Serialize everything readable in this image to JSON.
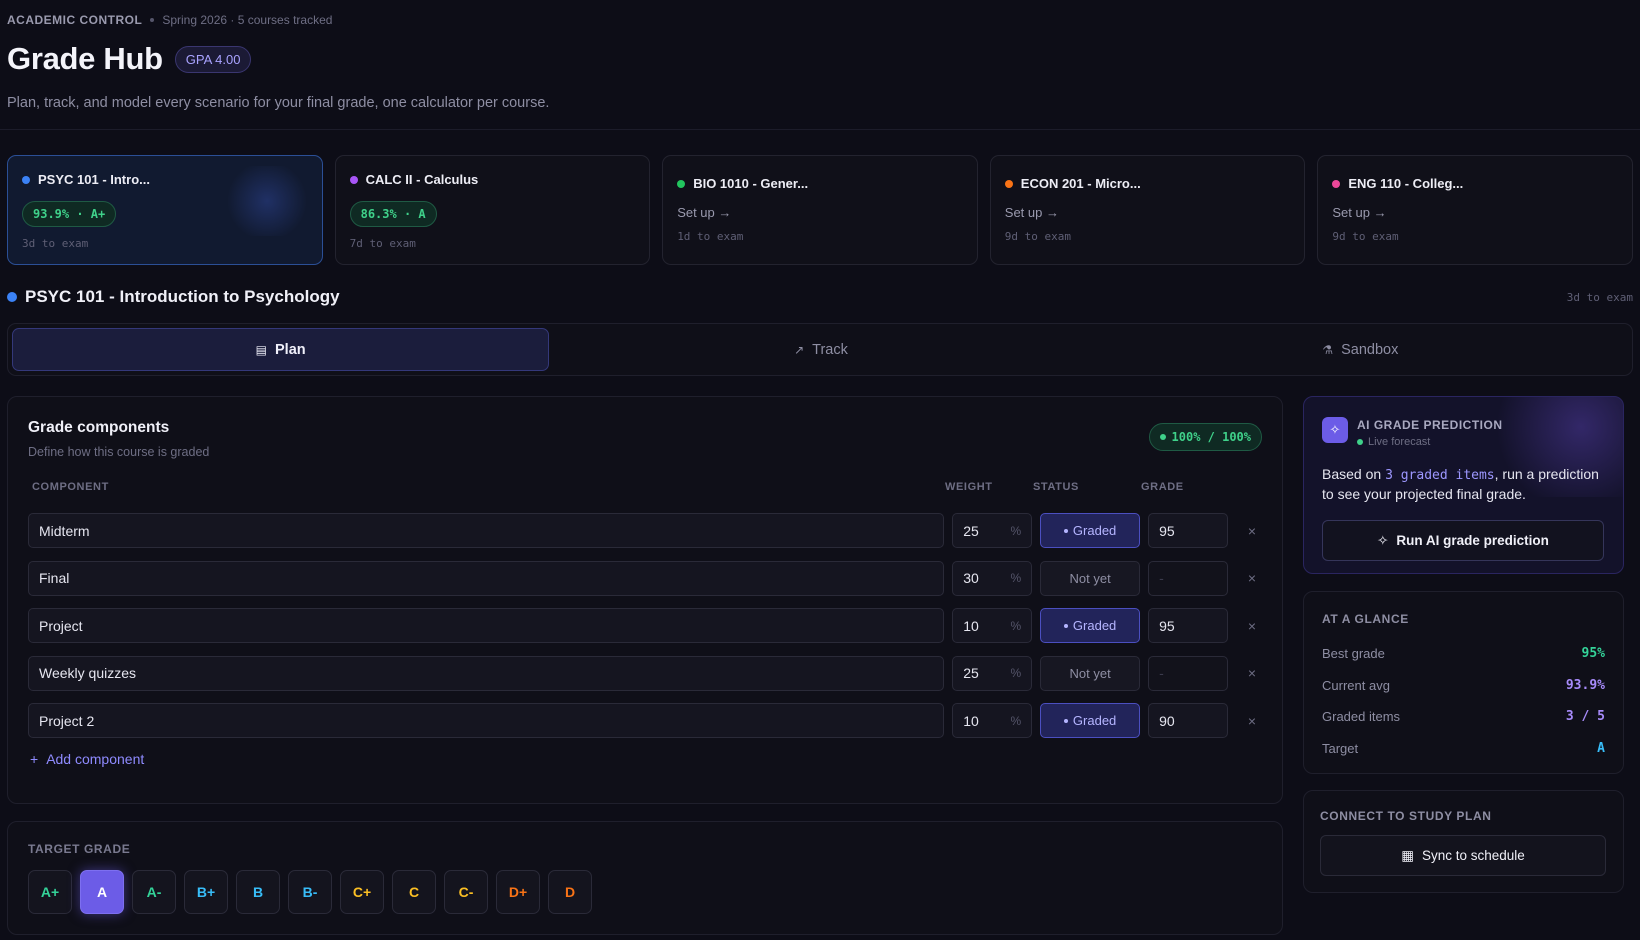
{
  "header": {
    "brand": "ACADEMIC CONTROL",
    "subtitle": "Spring 2026 · 5 courses tracked",
    "title": "Grade Hub",
    "gpa_badge": "GPA 4.00",
    "tagline": "Plan, track, and model every scenario for your final grade, one calculator per course."
  },
  "courses": [
    {
      "name": "PSYC 101 - Intro...",
      "dot_color": "#3b82f6",
      "pill": "93.9% · A+",
      "setup": "",
      "meta": "3d to exam",
      "active": true
    },
    {
      "name": "CALC II - Calculus",
      "dot_color": "#a855f7",
      "pill": "86.3% · A",
      "setup": "",
      "meta": "7d to exam",
      "active": false
    },
    {
      "name": "BIO 1010 - Gener...",
      "dot_color": "#22c55e",
      "pill": "",
      "setup": "Set up →",
      "meta": "1d to exam",
      "active": false
    },
    {
      "name": "ECON 201 - Micro...",
      "dot_color": "#f97316",
      "pill": "",
      "setup": "Set up →",
      "meta": "9d to exam",
      "active": false
    },
    {
      "name": "ENG 110 - Colleg...",
      "dot_color": "#ec4899",
      "pill": "",
      "setup": "Set up →",
      "meta": "9d to exam",
      "active": false
    }
  ],
  "course_heading": {
    "title": "PSYC 101 - Introduction to Psychology",
    "exam": "3d to exam"
  },
  "tabs": [
    {
      "label": "Plan",
      "icon": "clipboard-icon"
    },
    {
      "label": "Track",
      "icon": "trend-icon"
    },
    {
      "label": "Sandbox",
      "icon": "flask-icon"
    }
  ],
  "components": {
    "title": "Grade components",
    "desc": "Define how this course is graded",
    "total": "100% / 100%",
    "columns": [
      "COMPONENT",
      "WEIGHT",
      "STATUS",
      "GRADE"
    ],
    "weight_unit": "%",
    "rows": [
      {
        "name": "Midterm",
        "weight": "25",
        "status": "Graded",
        "grade": "95"
      },
      {
        "name": "Final",
        "weight": "30",
        "status": "Not yet",
        "grade": "-"
      },
      {
        "name": "Project",
        "weight": "10",
        "status": "Graded",
        "grade": "95"
      },
      {
        "name": "Weekly quizzes",
        "weight": "25",
        "status": "Not yet",
        "grade": "-"
      },
      {
        "name": "Project 2",
        "weight": "10",
        "status": "Graded",
        "grade": "90"
      }
    ],
    "add_label": "Add component"
  },
  "target": {
    "label": "TARGET GRADE",
    "grades": [
      {
        "label": "A+",
        "color": "#34d399"
      },
      {
        "label": "A",
        "color": "#ffffff",
        "active": true
      },
      {
        "label": "A-",
        "color": "#34d399"
      },
      {
        "label": "B+",
        "color": "#38bdf8"
      },
      {
        "label": "B",
        "color": "#38bdf8"
      },
      {
        "label": "B-",
        "color": "#38bdf8"
      },
      {
        "label": "C+",
        "color": "#fbbf24"
      },
      {
        "label": "C",
        "color": "#fbbf24"
      },
      {
        "label": "C-",
        "color": "#fbbf24"
      },
      {
        "label": "D+",
        "color": "#f97316"
      },
      {
        "label": "D",
        "color": "#f97316"
      }
    ]
  },
  "ai": {
    "title": "AI GRADE PREDICTION",
    "live": "Live forecast",
    "text_pre": "Based on ",
    "text_hl": "3 graded items",
    "text_post": ", run a prediction to see your projected final grade.",
    "button": "Run AI grade prediction"
  },
  "glance": {
    "label": "AT A GLANCE",
    "rows": [
      {
        "label": "Best grade",
        "value": "95%",
        "color": "#34d399"
      },
      {
        "label": "Current avg",
        "value": "93.9%",
        "color": "#a78bfa"
      },
      {
        "label": "Graded items",
        "value": "3 / 5",
        "color": "#a78bfa"
      },
      {
        "label": "Target",
        "value": "A",
        "color": "#38bdf8"
      }
    ]
  },
  "sync": {
    "label": "CONNECT TO STUDY PLAN",
    "button": "Sync to schedule"
  }
}
